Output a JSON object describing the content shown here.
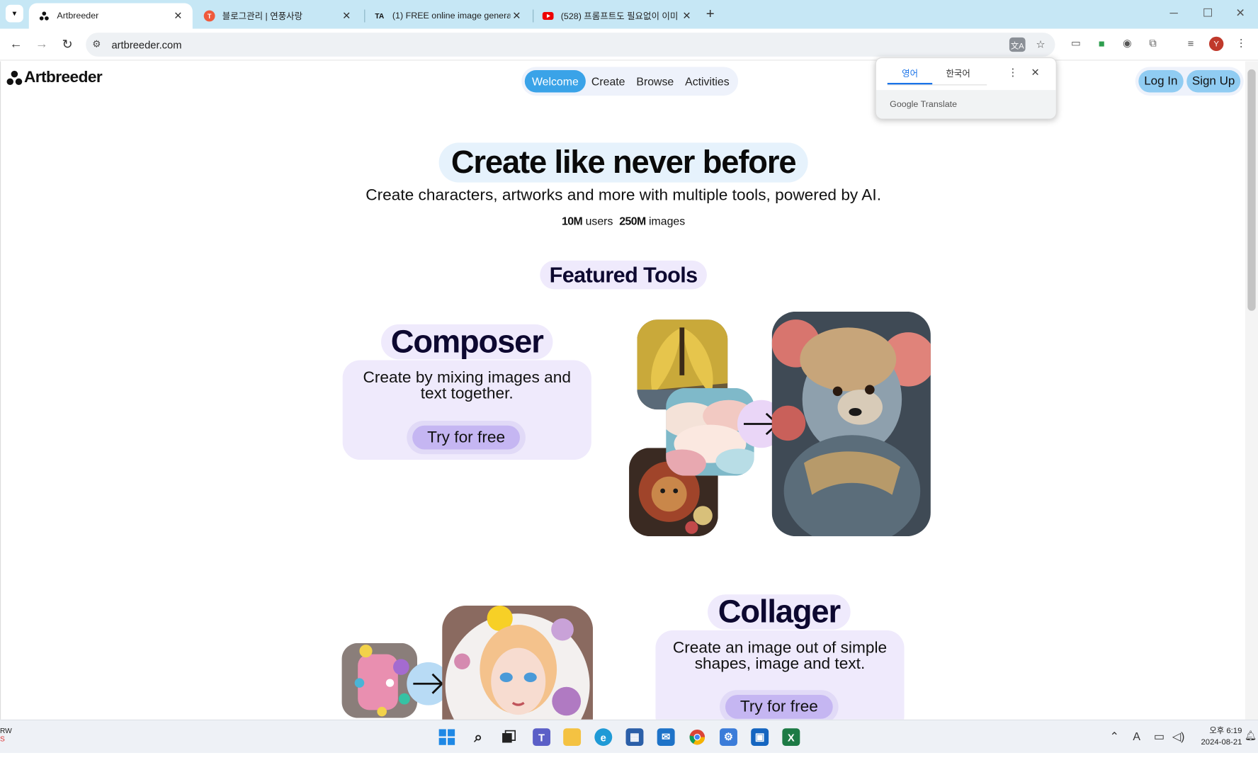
{
  "browser": {
    "tabs": [
      {
        "title": "Artbreeder",
        "active": true
      },
      {
        "title": "블로그관리 | 연풍사랑",
        "active": false
      },
      {
        "title": "(1) FREE online image generat",
        "active": false
      },
      {
        "title": "(528) 프롬프트도 필요없이 이미",
        "active": false
      }
    ],
    "new_tab": "+",
    "url": "artbreeder.com",
    "profile_initial": "Y"
  },
  "translate_popup": {
    "source_lang": "영어",
    "target_lang": "한국어",
    "brand_google": "Google",
    "brand_translate": "Translate"
  },
  "site": {
    "logo": "Artbreeder",
    "nav": [
      "Welcome",
      "Create",
      "Browse",
      "Activities"
    ],
    "auth": {
      "login": "Log In",
      "signup": "Sign Up"
    },
    "hero": {
      "title": "Create like never before",
      "subtitle": "Create characters, artworks and more with multiple tools, powered by AI."
    },
    "stats": {
      "users_value": "10M",
      "users_label": "users",
      "images_value": "250M",
      "images_label": "images"
    },
    "featured_heading": "Featured Tools",
    "tools": [
      {
        "name": "Composer",
        "desc_line1": "Create by mixing images and",
        "desc_line2": "text together.",
        "cta": "Try for free"
      },
      {
        "name": "Collager",
        "desc_line1": "Create an image out of simple",
        "desc_line2": "shapes, image and text.",
        "cta": "Try for free"
      }
    ]
  },
  "taskbar": {
    "left_text_1": "RW",
    "left_text_2": "S",
    "clock_ampm_time": "오후 6:19",
    "clock_date": "2024-08-21",
    "tray_font": "A"
  },
  "colors": {
    "tabstrip": "#c6e7f5",
    "nav_active": "#3aa3e8",
    "auth_button": "#90ccf2",
    "tool_card": "#efeafc",
    "try_button": "#c5b6f2"
  }
}
